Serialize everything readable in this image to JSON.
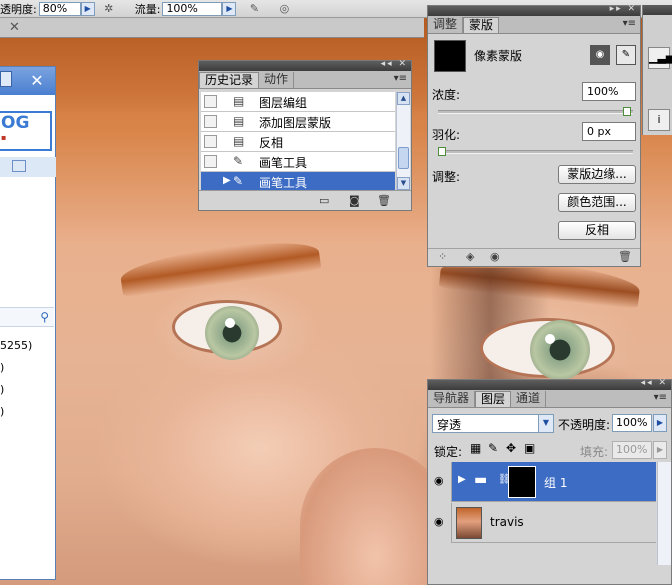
{
  "topbar": {
    "opacity_label": "透明度:",
    "opacity_value": "80%",
    "flow_label": "流量:",
    "flow_value": "100%"
  },
  "history": {
    "tabs": [
      "历史记录",
      "动作"
    ],
    "items": [
      {
        "label": "图层编组",
        "icon": "layers-icon"
      },
      {
        "label": "添加图层蒙版",
        "icon": "document-icon"
      },
      {
        "label": "反相",
        "icon": "document-icon"
      },
      {
        "label": "画笔工具",
        "icon": "brush-icon"
      },
      {
        "label": "画笔工具",
        "icon": "brush-icon",
        "selected": true
      }
    ]
  },
  "masks": {
    "tabs": [
      "调整",
      "蒙版"
    ],
    "mask_type": "像素蒙版",
    "density_label": "浓度:",
    "density_value": "100%",
    "density_level": 1.0,
    "feather_label": "羽化:",
    "feather_value": "0 px",
    "feather_level": 0.0,
    "adjust_label": "调整:",
    "buttons": {
      "mask_edge": "蒙版边缘...",
      "color_range": "颜色范围...",
      "invert": "反相"
    }
  },
  "layers": {
    "tabs": [
      "导航器",
      "图层",
      "通道"
    ],
    "blend_mode": "穿透",
    "opacity_label": "不透明度:",
    "opacity_value": "100%",
    "lock_label": "锁定:",
    "fill_label": "填充:",
    "fill_value": "100%",
    "items": [
      {
        "name": "组 1",
        "type": "group",
        "selected": true
      },
      {
        "name": "travis",
        "type": "image",
        "selected": false
      }
    ]
  },
  "leftwin": {
    "logo_text": "OG",
    "rows": [
      "5255)",
      ")",
      ")",
      ")"
    ]
  },
  "colors": {
    "selection": "#3d6cc4",
    "panel_bg": "#d4d4d4"
  }
}
